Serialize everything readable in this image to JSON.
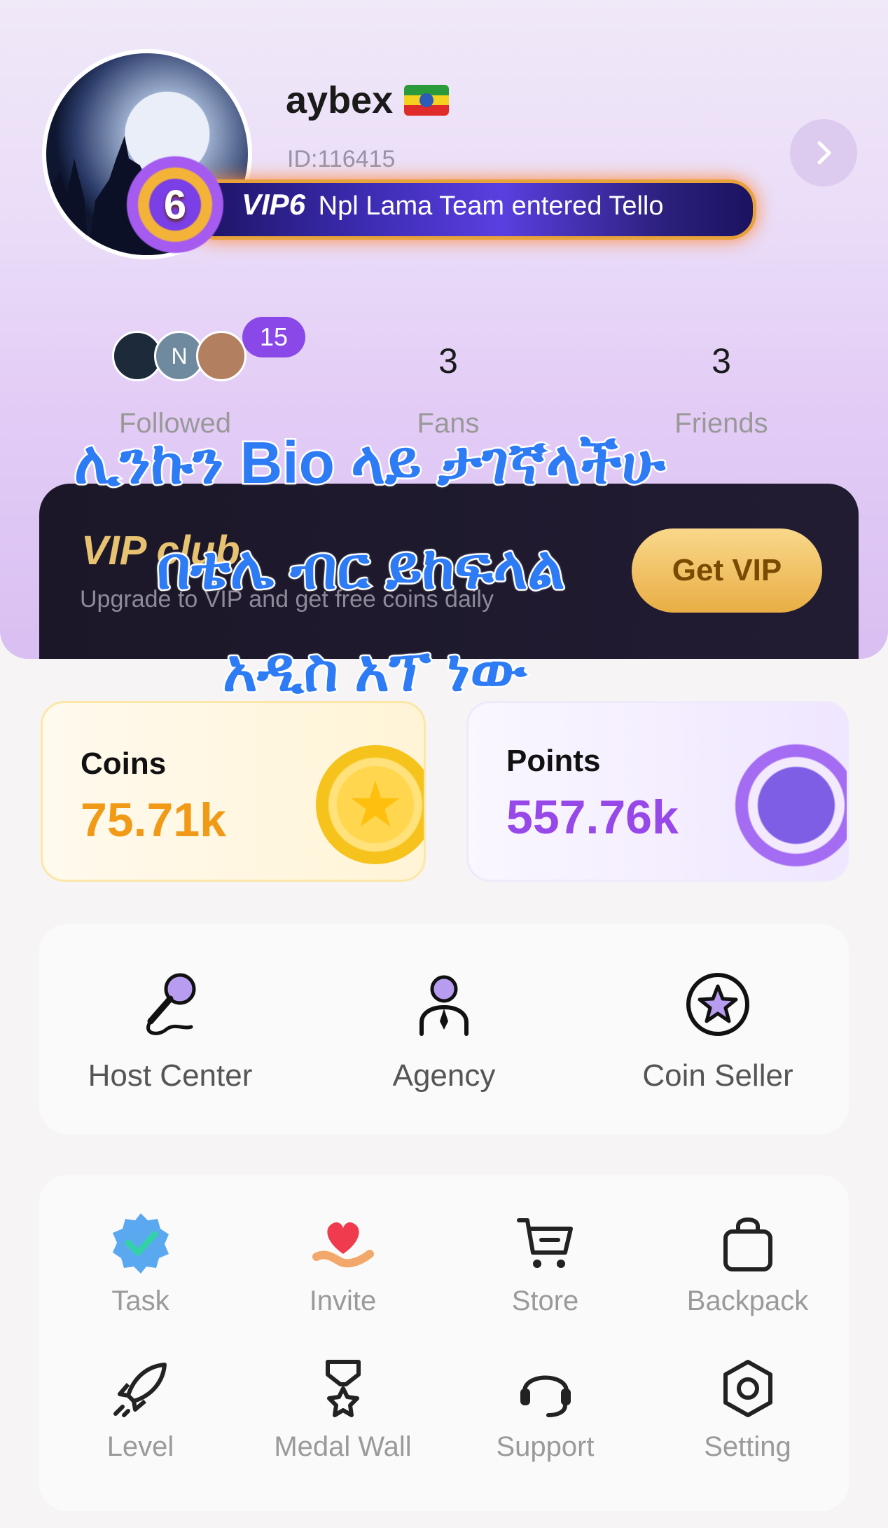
{
  "profile": {
    "username": "aybex",
    "user_id": "ID:116415",
    "flag_icon": "ethiopia-flag-icon"
  },
  "vip_banner": {
    "level": "6",
    "vip_tag": "VIP6",
    "message": "Npl Lama Team entered Tello"
  },
  "stats": {
    "followed_count_badge": "15",
    "followed_avatar_initial": "N",
    "followed_label": "Followed",
    "fans_value": "3",
    "fans_label": "Fans",
    "friends_value": "3",
    "friends_label": "Friends"
  },
  "vip_club": {
    "title": "VIP club",
    "subtitle": "Upgrade to VIP and get free coins daily",
    "button": "Get VIP"
  },
  "overlay_text": {
    "line1": "ሊንኩን Bio ላይ ታገኛላችሁ",
    "line2": "በቴሌ ብር ይከፍላል",
    "line3": "አዲስ አፕ ነው"
  },
  "wallet": {
    "coins_label": "Coins",
    "coins_value": "75.71k",
    "points_label": "Points",
    "points_value": "557.76k"
  },
  "tools": [
    {
      "label": "Host Center",
      "icon": "microphone-icon"
    },
    {
      "label": "Agency",
      "icon": "agent-person-icon"
    },
    {
      "label": "Coin Seller",
      "icon": "star-coin-icon"
    }
  ],
  "menu": [
    {
      "label": "Task",
      "icon": "verified-badge-icon"
    },
    {
      "label": "Invite",
      "icon": "heart-hand-icon"
    },
    {
      "label": "Store",
      "icon": "cart-icon"
    },
    {
      "label": "Backpack",
      "icon": "bag-icon"
    },
    {
      "label": "Level",
      "icon": "rocket-icon"
    },
    {
      "label": "Medal Wall",
      "icon": "medal-icon"
    },
    {
      "label": "Support",
      "icon": "headset-icon"
    },
    {
      "label": "Setting",
      "icon": "settings-icon"
    }
  ],
  "colors": {
    "coins": "#f19a17",
    "points": "#9748e8",
    "overlay_text": "#2e7bf6",
    "vip_gold": "#e7c271"
  }
}
